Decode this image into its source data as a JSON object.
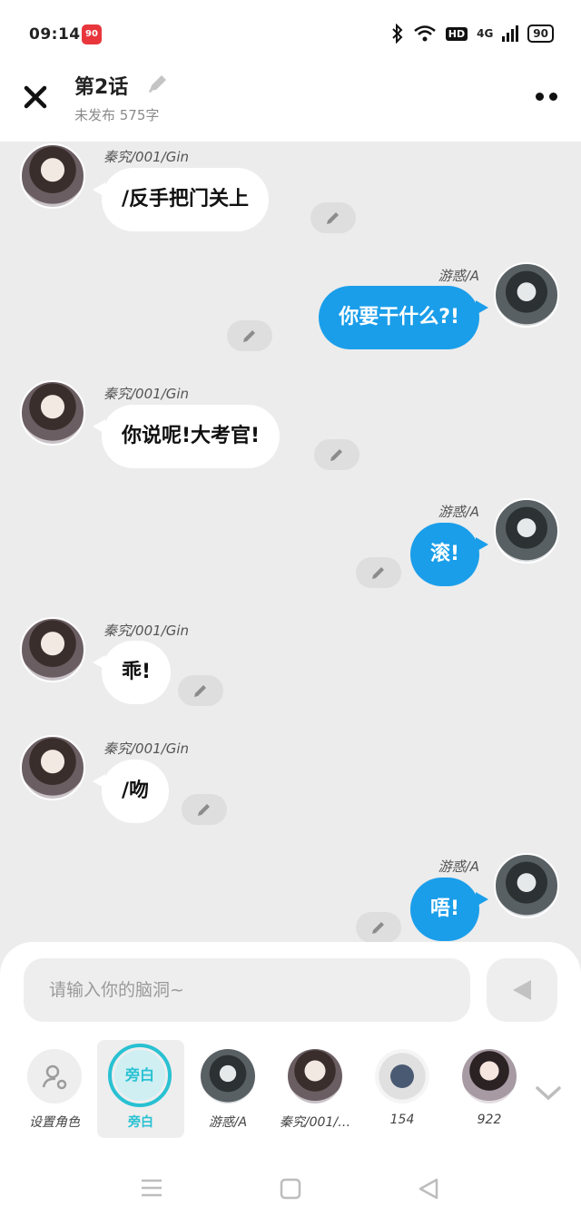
{
  "status": {
    "time": "09:14",
    "app_badge": "90",
    "network": "4G",
    "hd": "HD",
    "battery": "90"
  },
  "header": {
    "title": "第2话",
    "subtitle": "未发布 575字"
  },
  "messages": [
    {
      "side": "left",
      "name": "秦究/001/Gin",
      "text": "/反手把门关上"
    },
    {
      "side": "right",
      "name": "游惑/A",
      "text": "你要干什么?!"
    },
    {
      "side": "left",
      "name": "秦究/001/Gin",
      "text": "你说呢!大考官!"
    },
    {
      "side": "right",
      "name": "游惑/A",
      "text": "滚!"
    },
    {
      "side": "left",
      "name": "秦究/001/Gin",
      "text": "乖!"
    },
    {
      "side": "left",
      "name": "秦究/001/Gin",
      "text": "/吻"
    },
    {
      "side": "right",
      "name": "游惑/A",
      "text": "唔!"
    }
  ],
  "composer": {
    "placeholder": "请输入你的脑洞~"
  },
  "roles": [
    {
      "label": "设置角色",
      "icon": "person-settings-icon"
    },
    {
      "label": "旁白",
      "circle_text": "旁白",
      "active": true
    },
    {
      "label": "游惑/A"
    },
    {
      "label": "秦究/001/…"
    },
    {
      "label": "154"
    },
    {
      "label": "922"
    }
  ],
  "colors": {
    "accent": "#1a9eea",
    "narration": "#28c1d2"
  }
}
